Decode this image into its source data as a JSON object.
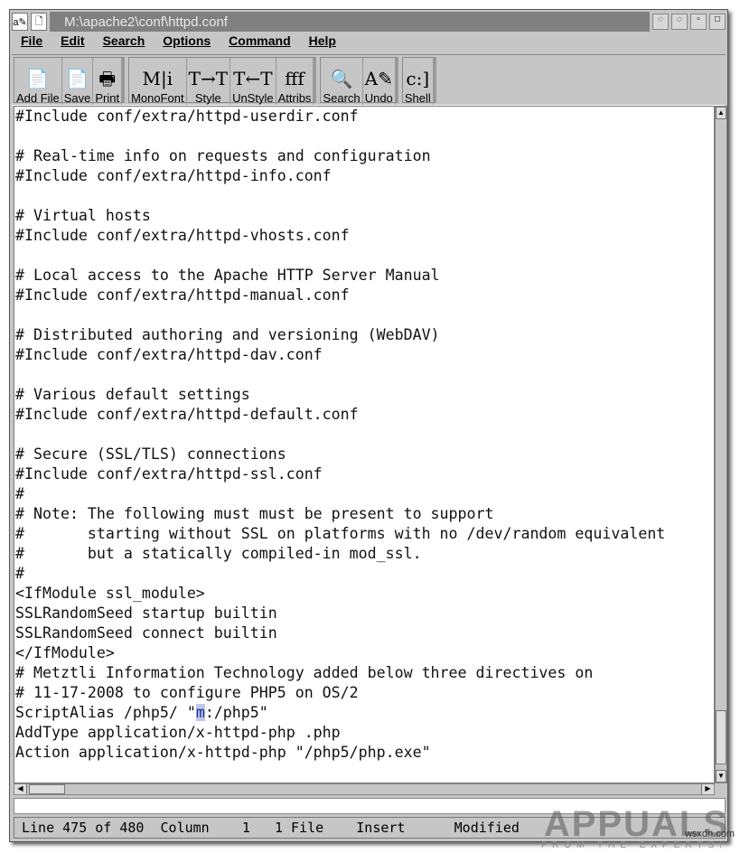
{
  "window": {
    "title": "M:\\apache2\\conf\\httpd.conf"
  },
  "menu": [
    "File",
    "Edit",
    "Search",
    "Options",
    "Command",
    "Help"
  ],
  "toolbar": [
    [
      {
        "label": "Add File",
        "icon": "add-file-icon",
        "glyph": "📄"
      },
      {
        "label": "Save",
        "icon": "save-icon",
        "glyph": "📄"
      },
      {
        "label": "Print",
        "icon": "print-icon",
        "glyph": "🖶"
      }
    ],
    [
      {
        "label": "MonoFont",
        "icon": "monofont-icon",
        "glyph": "M|i"
      },
      {
        "label": "Style",
        "icon": "style-icon",
        "glyph": "T→T"
      },
      {
        "label": "UnStyle",
        "icon": "unstyle-icon",
        "glyph": "T←T"
      },
      {
        "label": "Attribs",
        "icon": "attribs-icon",
        "glyph": "fff"
      }
    ],
    [
      {
        "label": "Search",
        "icon": "search-icon",
        "glyph": "🔍"
      },
      {
        "label": "Undo",
        "icon": "undo-icon",
        "glyph": "A✎"
      }
    ],
    [
      {
        "label": "Shell",
        "icon": "shell-icon",
        "glyph": "c:]"
      }
    ]
  ],
  "editor": {
    "lines": [
      "#Include conf/extra/httpd-userdir.conf",
      "",
      "# Real-time info on requests and configuration",
      "#Include conf/extra/httpd-info.conf",
      "",
      "# Virtual hosts",
      "#Include conf/extra/httpd-vhosts.conf",
      "",
      "# Local access to the Apache HTTP Server Manual",
      "#Include conf/extra/httpd-manual.conf",
      "",
      "# Distributed authoring and versioning (WebDAV)",
      "#Include conf/extra/httpd-dav.conf",
      "",
      "# Various default settings",
      "#Include conf/extra/httpd-default.conf",
      "",
      "# Secure (SSL/TLS) connections",
      "#Include conf/extra/httpd-ssl.conf",
      "#",
      "# Note: The following must must be present to support",
      "#       starting without SSL on platforms with no /dev/random equivalent",
      "#       but a statically compiled-in mod_ssl.",
      "#",
      "<IfModule ssl_module>",
      "SSLRandomSeed startup builtin",
      "SSLRandomSeed connect builtin",
      "</IfModule>",
      "# Metztli Information Technology added below three directives on",
      "# 11-17-2008 to configure PHP5 on OS/2",
      "ScriptAlias /php5/ \"m:/php5\"",
      "AddType application/x-httpd-php .php",
      "Action application/x-httpd-php \"/php5/php.exe\""
    ],
    "cursor_line": 30,
    "cursor_col": 20
  },
  "status": {
    "line": "Line 475 of 480",
    "column": "Column    1",
    "files": "1 File",
    "mode": "Insert",
    "modified": "Modified"
  },
  "watermark": {
    "brand": "APPUALS",
    "tagline": "FROM THE EXPERTS!",
    "site": "wsxdn.com"
  }
}
